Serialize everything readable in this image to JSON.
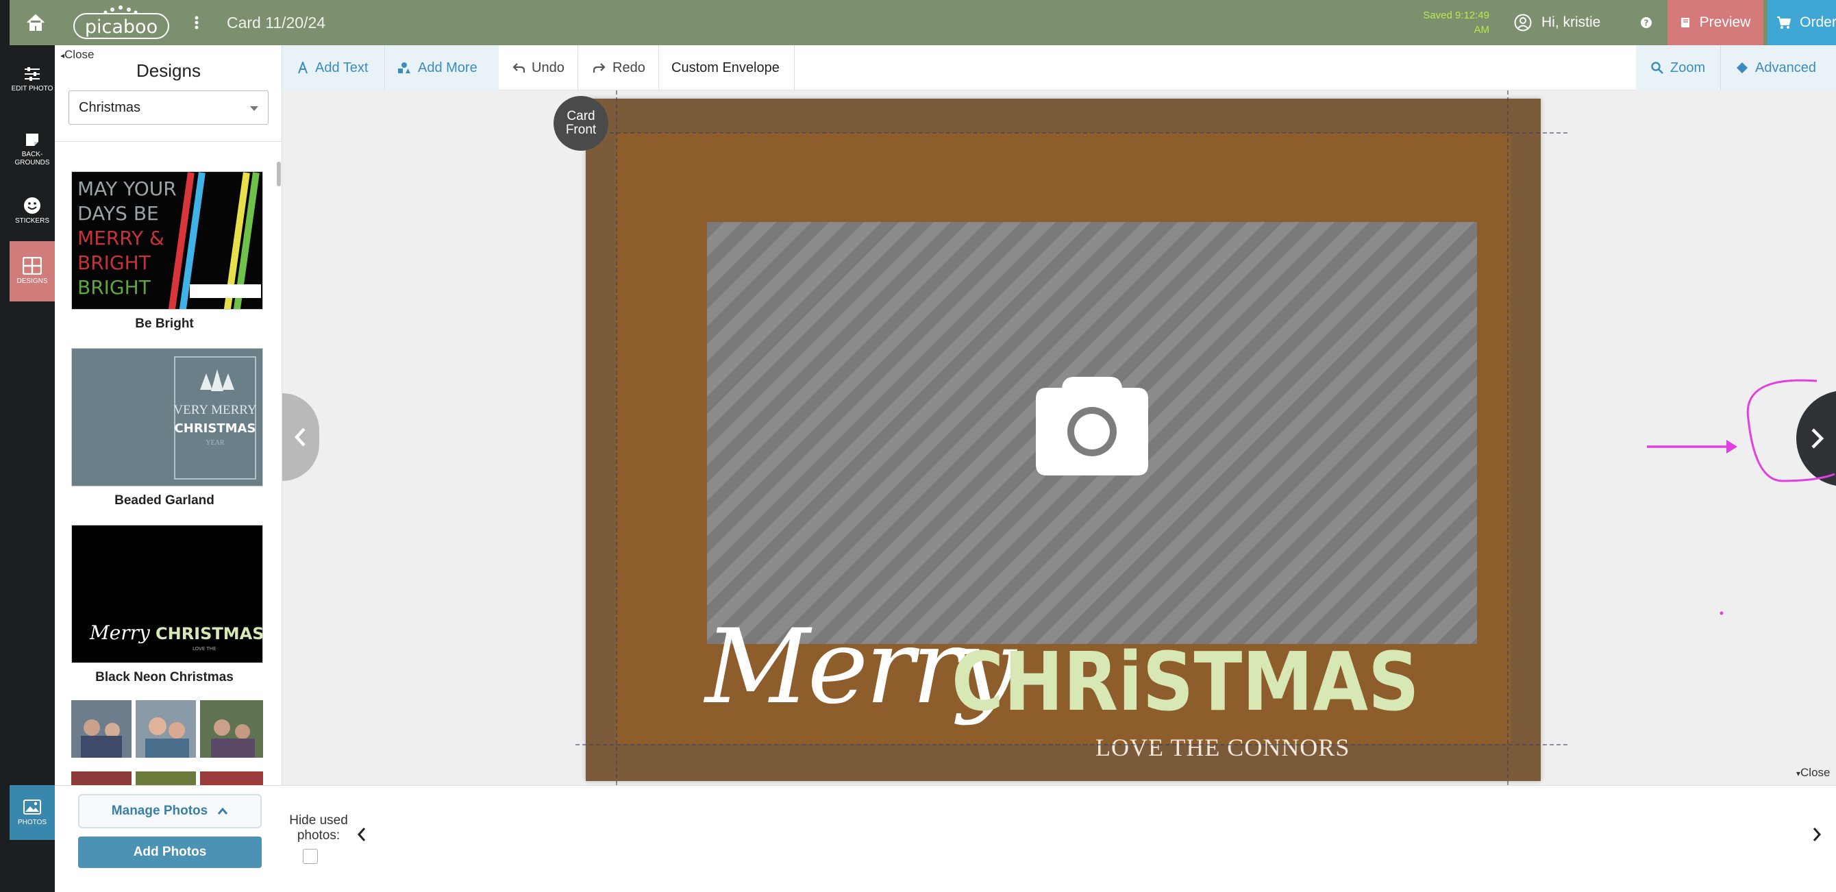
{
  "topbar": {
    "logo": "picaboo",
    "title": "Card 11/20/24",
    "saved": "Saved 9:12:49 AM",
    "user_greeting": "Hi, kristie",
    "preview_label": "Preview",
    "order_label": "Order",
    "bg_color": "#7c8f6e"
  },
  "nav": {
    "edit_photo": "EDIT PHOTO",
    "backgrounds": "BACK-GROUNDS",
    "stickers": "STICKERS",
    "designs": "DESIGNS",
    "photos": "PHOTOS",
    "active_color": "#cf7c7b"
  },
  "designs_panel": {
    "close": "Close",
    "heading": "Designs",
    "category": "Christmas",
    "items": [
      {
        "name": "Be Bright",
        "thumb_text": "MAY YOUR DAYS BE MERRY & BRIGHT"
      },
      {
        "name": "Beaded Garland",
        "thumb_text": "VERY MERRY CHRISTMAS"
      },
      {
        "name": "Black Neon Christmas",
        "thumb_text": "Merry CHRISTMAS"
      }
    ]
  },
  "toolbar": {
    "add_text": "Add Text",
    "add_more": "Add More",
    "undo": "Undo",
    "redo": "Redo",
    "custom_envelope": "Custom Envelope",
    "zoom": "Zoom",
    "advanced": "Advanced"
  },
  "card": {
    "badge_line1": "Card",
    "badge_line2": "Front",
    "merry": "Merry",
    "christmas": "CHRiSTMAS",
    "signature": "LOVE THE CONNORS",
    "outer_color": "#7c5b3b",
    "inner_color": "#8d5d2c",
    "christmas_color": "#d7e8b4"
  },
  "canvas": {
    "close": "Close"
  },
  "bottom": {
    "manage_photos": "Manage Photos",
    "add_photos": "Add Photos",
    "hide_used": "Hide used photos:"
  }
}
